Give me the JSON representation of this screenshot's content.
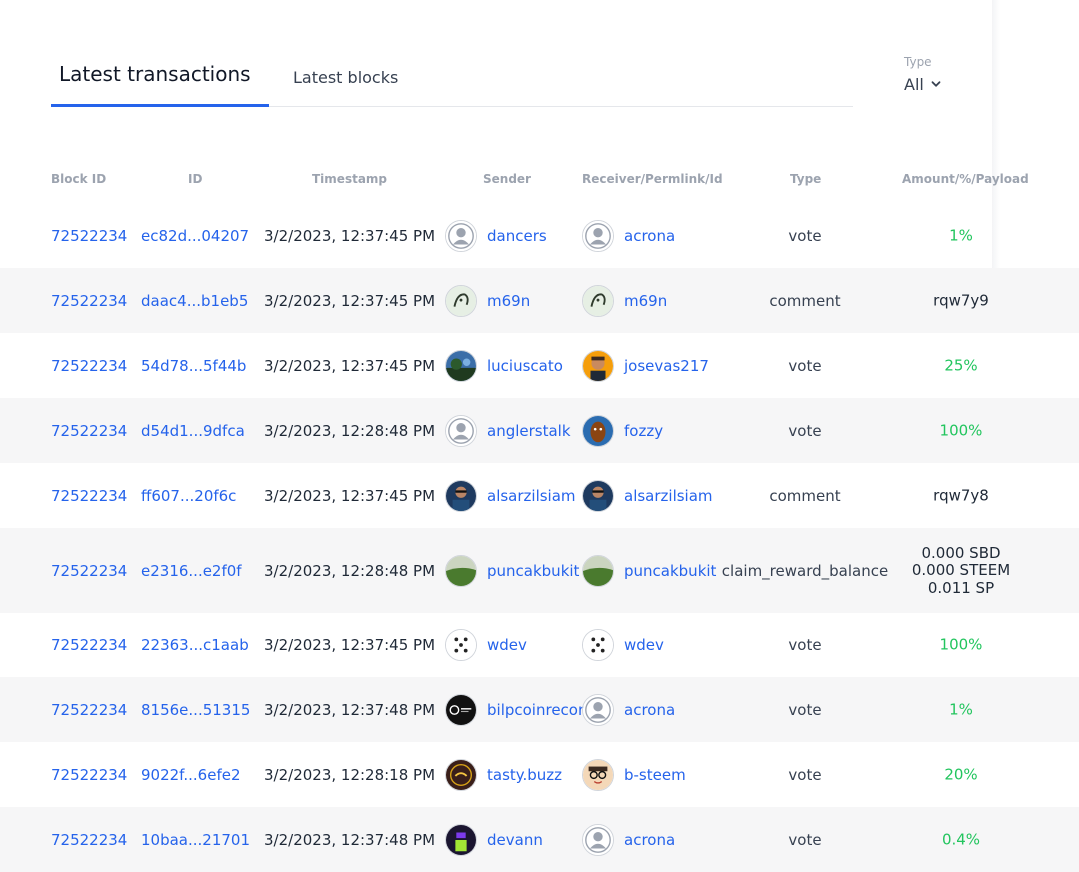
{
  "tabs": {
    "active_label": "Latest transactions",
    "inactive_label": "Latest blocks"
  },
  "filter": {
    "label": "Type",
    "value": "All"
  },
  "table": {
    "headers": {
      "block_id": "Block ID",
      "id": "ID",
      "timestamp": "Timestamp",
      "sender": "Sender",
      "receiver": "Receiver/Permlink/Id",
      "type": "Type",
      "amount": "Amount/%/Payload"
    },
    "rows": [
      {
        "block": "72522234",
        "id": "ec82d...04207",
        "ts": "3/2/2023, 12:37:45 PM",
        "sender": "dancers",
        "receiver": "acrona",
        "type": "vote",
        "amount": "1%",
        "sender_avatar": "default-avatar-icon",
        "receiver_avatar": "default-avatar-icon"
      },
      {
        "block": "72522234",
        "id": "daac4...b1eb5",
        "ts": "3/2/2023, 12:37:45 PM",
        "sender": "m69n",
        "receiver": "m69n",
        "type": "comment",
        "amount": "rqw7y9",
        "sender_avatar": "face-sketch-avatar",
        "receiver_avatar": "face-sketch-avatar"
      },
      {
        "block": "72522234",
        "id": "54d78...5f44b",
        "ts": "3/2/2023, 12:37:45 PM",
        "sender": "luciuscato",
        "receiver": "josevas217",
        "type": "vote",
        "amount": "25%",
        "sender_avatar": "landscape-avatar",
        "receiver_avatar": "cartoon-man-avatar"
      },
      {
        "block": "72522234",
        "id": "d54d1...9dfca",
        "ts": "3/2/2023, 12:28:48 PM",
        "sender": "anglerstalk",
        "receiver": "fozzy",
        "type": "vote",
        "amount": "100%",
        "sender_avatar": "default-avatar-icon",
        "receiver_avatar": "character-avatar"
      },
      {
        "block": "72522234",
        "id": "ff607...20f6c",
        "ts": "3/2/2023, 12:37:45 PM",
        "sender": "alsarzilsiam",
        "receiver": "alsarzilsiam",
        "type": "comment",
        "amount": "rqw7y8",
        "sender_avatar": "photo-man-avatar",
        "receiver_avatar": "photo-man-avatar"
      },
      {
        "block": "72522234",
        "id": "e2316...e2f0f",
        "ts": "3/2/2023, 12:28:48 PM",
        "sender": "puncakbukit",
        "receiver": "puncakbukit",
        "type": "claim_reward_balance",
        "amount_lines": [
          "0.000 SBD",
          "0.000 STEEM",
          "0.011 SP"
        ],
        "sender_avatar": "hill-avatar",
        "receiver_avatar": "hill-avatar"
      },
      {
        "block": "72522234",
        "id": "22363...c1aab",
        "ts": "3/2/2023, 12:37:45 PM",
        "sender": "wdev",
        "receiver": "wdev",
        "type": "vote",
        "amount": "100%",
        "sender_avatar": "dice-avatar",
        "receiver_avatar": "dice-avatar"
      },
      {
        "block": "72522234",
        "id": "8156e...51315",
        "ts": "3/2/2023, 12:37:48 PM",
        "sender": "bilpcoinrecords",
        "receiver": "acrona",
        "type": "vote",
        "amount": "1%",
        "sender_avatar": "record-logo-avatar",
        "receiver_avatar": "default-avatar-icon"
      },
      {
        "block": "72522234",
        "id": "9022f...6efe2",
        "ts": "3/2/2023, 12:28:18 PM",
        "sender": "tasty.buzz",
        "receiver": "b-steem",
        "type": "vote",
        "amount": "20%",
        "sender_avatar": "buzz-logo-avatar",
        "receiver_avatar": "glasses-cartoon-avatar"
      },
      {
        "block": "72522234",
        "id": "10baa...21701",
        "ts": "3/2/2023, 12:37:48 PM",
        "sender": "devann",
        "receiver": "acrona",
        "type": "vote",
        "amount": "0.4%",
        "sender_avatar": "dark-figure-avatar",
        "receiver_avatar": "default-avatar-icon"
      }
    ]
  },
  "colors": {
    "link": "#2563eb",
    "positive": "#22c55e",
    "tab_indicator": "#2563eb",
    "row_stripe": "#f6f6f7"
  }
}
